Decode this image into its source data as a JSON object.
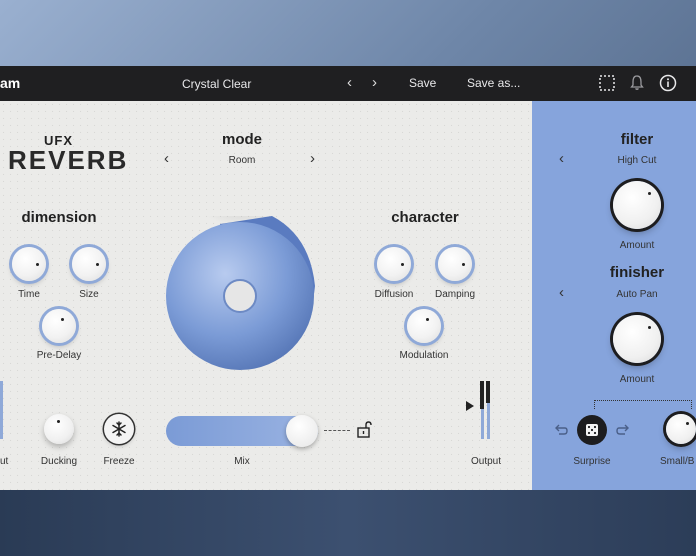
{
  "header": {
    "brand": "am",
    "preset_name": "Crystal Clear",
    "prev_symbol": "‹",
    "next_symbol": "›",
    "save_label": "Save",
    "save_as_label": "Save as..."
  },
  "logo": {
    "top": "UFX",
    "main": "REVERB"
  },
  "mode": {
    "title": "mode",
    "value": "Room",
    "prev": "‹",
    "next": "›"
  },
  "dimension": {
    "title": "dimension",
    "knobs": [
      {
        "label": "Time"
      },
      {
        "label": "Size"
      },
      {
        "label": "Pre-Delay"
      }
    ]
  },
  "character": {
    "title": "character",
    "knobs": [
      {
        "label": "Diffusion"
      },
      {
        "label": "Damping"
      },
      {
        "label": "Modulation"
      }
    ]
  },
  "bottom": {
    "input_label": "ut",
    "ducking_label": "Ducking",
    "freeze_label": "Freeze",
    "mix_label": "Mix",
    "output_label": "Output"
  },
  "filter": {
    "title": "filter",
    "value": "High Cut",
    "prev": "‹",
    "amount_label": "Amount"
  },
  "finisher": {
    "title": "finisher",
    "value": "Auto Pan",
    "prev": "‹",
    "amount_label": "Amount"
  },
  "sidebar_bottom": {
    "surprise_label": "Surprise",
    "smallbig_label": "Small/B"
  },
  "colors": {
    "accent": "#86a4dc",
    "topbar": "#1f1f21",
    "panel": "#ebebe9"
  }
}
